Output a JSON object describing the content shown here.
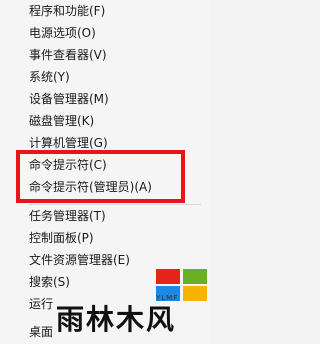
{
  "menu": {
    "items": [
      {
        "label": "程序和功能(F)"
      },
      {
        "label": "电源选项(O)"
      },
      {
        "label": "事件查看器(V)"
      },
      {
        "label": "系统(Y)"
      },
      {
        "label": "设备管理器(M)"
      },
      {
        "label": "磁盘管理(K)"
      },
      {
        "label": "计算机管理(G)"
      },
      {
        "label": "命令提示符(C)"
      },
      {
        "label": "命令提示符(管理员)(A)"
      },
      {
        "label": "任务管理器(T)"
      },
      {
        "label": "控制面板(P)"
      },
      {
        "label": "文件资源管理器(E)"
      },
      {
        "label": "搜索(S)"
      },
      {
        "label": "运行"
      },
      {
        "label": "桌面"
      }
    ]
  },
  "watermark": {
    "logo_text": "雨林木风",
    "sub_text": "YLMF"
  },
  "colors": {
    "highlight": "#e8131b",
    "logo_red": "#e8231b",
    "logo_green": "#6ab023",
    "logo_blue": "#1e88e5",
    "logo_yellow": "#f5b400"
  }
}
